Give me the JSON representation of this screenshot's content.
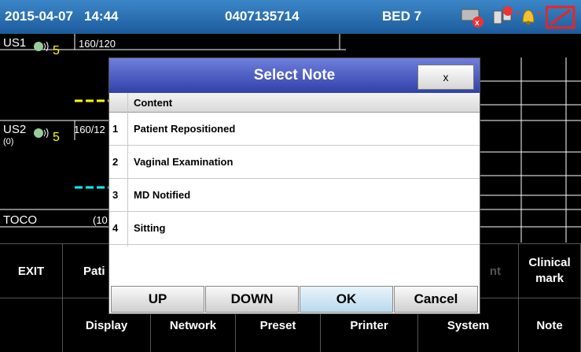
{
  "topbar": {
    "date": "2015-04-07",
    "time": "14:44",
    "patient_id": "0407135714",
    "bed": "BED 7",
    "icons": [
      "network-error-icon",
      "connection-error-icon",
      "alarm-bell-icon",
      "battery-icon"
    ]
  },
  "channels": {
    "us1": {
      "label": "US1",
      "value": "5",
      "scale": "160/120"
    },
    "us2": {
      "label": "US2",
      "sub": "(0)",
      "value": "5",
      "scale": "160/12"
    },
    "toco": {
      "label": "TOCO",
      "value": "(10"
    }
  },
  "dialog": {
    "title": "Select Note",
    "close_label": "x",
    "column_header": "Content",
    "rows": [
      {
        "num": "1",
        "text": "Patient Repositioned"
      },
      {
        "num": "2",
        "text": "Vaginal Examination"
      },
      {
        "num": "3",
        "text": "MD Notified"
      },
      {
        "num": "4",
        "text": "Sitting"
      }
    ],
    "buttons": {
      "up": "UP",
      "down": "DOWN",
      "ok": "OK",
      "cancel": "Cancel"
    }
  },
  "bottom_row1": {
    "exit": "EXIT",
    "patient_partial": "Pati",
    "hidden_partial": "nt",
    "clinical_mark": "Clinical mark"
  },
  "bottom_row2": {
    "display": "Display",
    "network": "Network",
    "preset": "Preset",
    "printer": "Printer",
    "system": "System",
    "note": "Note"
  },
  "colors": {
    "us1_trace": "#ffff00",
    "us2_trace": "#00ffff",
    "value": "#ffff00"
  }
}
